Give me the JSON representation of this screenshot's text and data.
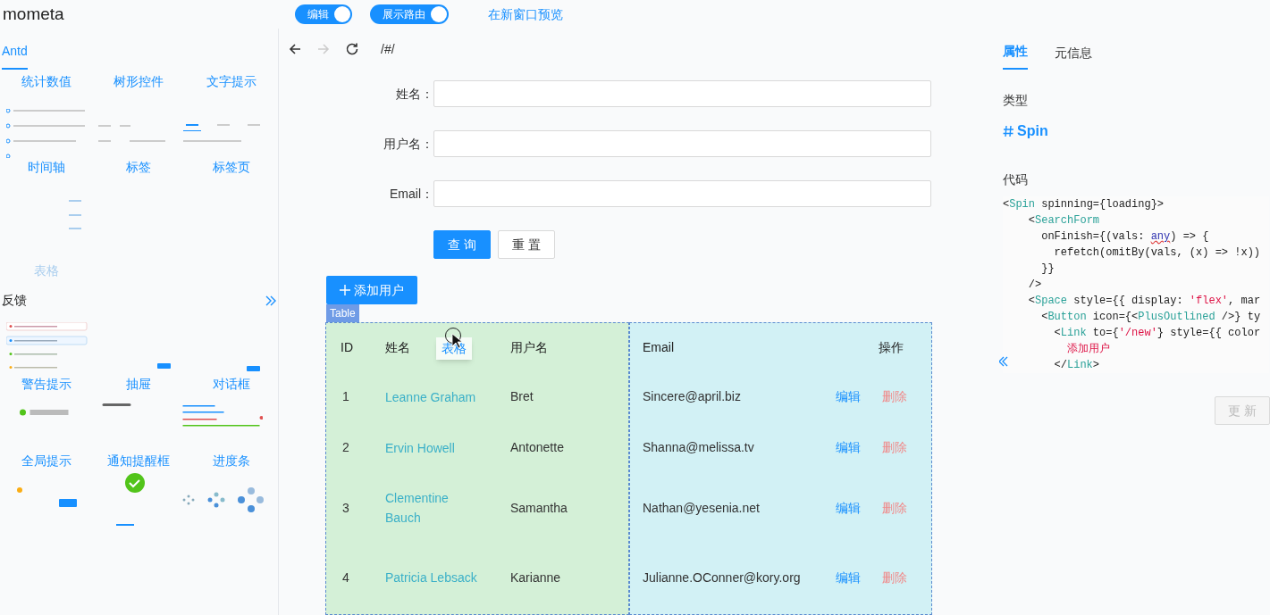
{
  "header": {
    "logo": "mometa",
    "toggles": [
      {
        "label": "编辑",
        "on": true
      },
      {
        "label": "展示路由",
        "on": true
      }
    ],
    "preview_link": "在新窗口预览"
  },
  "left_panel": {
    "tab": {
      "label": "Antd",
      "selected": true
    },
    "sections": [
      {
        "rows": [
          [
            {
              "label": "统计数值",
              "dragging": false
            },
            {
              "label": "树形控件",
              "dragging": false
            },
            {
              "label": "文字提示",
              "dragging": false
            }
          ],
          [
            {
              "label": "时间轴",
              "dragging": false
            },
            {
              "label": "标签",
              "dragging": false
            },
            {
              "label": "标签页",
              "dragging": false
            }
          ],
          [
            {
              "label": "表格",
              "dragging": true
            }
          ]
        ]
      },
      {
        "title": "反馈",
        "rows": [
          [
            {
              "label": "警告提示",
              "dragging": false
            },
            {
              "label": "抽屉",
              "dragging": false
            },
            {
              "label": "对话框",
              "dragging": false
            }
          ],
          [
            {
              "label": "全局提示",
              "dragging": false
            },
            {
              "label": "通知提醒框",
              "dragging": false
            },
            {
              "label": "进度条",
              "dragging": false
            }
          ]
        ]
      }
    ]
  },
  "browser_bar": {
    "back_disabled": false,
    "forward_disabled": true,
    "path": "/#/"
  },
  "form": {
    "fields": [
      {
        "label": "姓名："
      },
      {
        "label": "用户名："
      },
      {
        "label": "Email："
      }
    ],
    "buttons": [
      {
        "label": "查 询",
        "kind": "primary"
      },
      {
        "label": "重 置",
        "kind": "default"
      }
    ]
  },
  "add_button": "添加用户",
  "table": {
    "tag": "Table",
    "drag_ghost": "表格",
    "columns": [
      "ID",
      "姓名",
      "用户名",
      "Email",
      "操作"
    ],
    "rows": [
      {
        "id": "1",
        "name": "Leanne Graham",
        "username": "Bret",
        "email": "Sincere@april.biz",
        "actions": [
          "编辑",
          "删除"
        ]
      },
      {
        "id": "2",
        "name": "Ervin Howell",
        "username": "Antonette",
        "email": "Shanna@melissa.tv",
        "actions": [
          "编辑",
          "删除"
        ]
      },
      {
        "id": "3",
        "name": "Clementine Bauch",
        "username": "Samantha",
        "email": "Nathan@yesenia.net",
        "actions": [
          "编辑",
          "删除"
        ]
      },
      {
        "id": "4",
        "name": "Patricia Lebsack",
        "username": "Karianne",
        "email": "Julianne.OConner@kory.org",
        "actions": [
          "编辑",
          "删除"
        ]
      }
    ]
  },
  "right_panel": {
    "tabs": [
      {
        "label": "属性",
        "selected": true
      },
      {
        "label": "元信息",
        "selected": false
      }
    ],
    "type_label": "类型",
    "type_value": "Spin",
    "code_label": "代码",
    "code": [
      [
        {
          "plain": "<"
        },
        {
          "tag": "Spin"
        },
        {
          "plain": " spinning={loading}>"
        }
      ],
      [
        {
          "plain": "    <"
        },
        {
          "tag": "SearchForm"
        }
      ],
      [
        {
          "plain": "      onFinish={(vals: "
        },
        {
          "type": "any"
        },
        {
          "plain": ") => {"
        }
      ],
      [
        {
          "plain": "        refetch(omitBy(vals, (x) => !x))"
        }
      ],
      [
        {
          "plain": "      }}"
        }
      ],
      [
        {
          "plain": "    />"
        }
      ],
      [
        {
          "plain": "    <"
        },
        {
          "tag": "Space"
        },
        {
          "plain": " style={{ display: "
        },
        {
          "string": "'flex'"
        },
        {
          "plain": ", mar"
        }
      ],
      [
        {
          "plain": "      <"
        },
        {
          "tag": "Button"
        },
        {
          "plain": " icon={<"
        },
        {
          "tag": "PlusOutlined"
        },
        {
          "plain": " />} ty"
        }
      ],
      [
        {
          "plain": "        <"
        },
        {
          "tag": "Link"
        },
        {
          "plain": " to={"
        },
        {
          "string": "'/new'"
        },
        {
          "plain": "} style={{ color"
        }
      ],
      [
        {
          "string": "          添加用户"
        }
      ],
      [
        {
          "plain": "        </"
        },
        {
          "tag": "Link"
        },
        {
          "plain": ">"
        }
      ]
    ],
    "update_button": {
      "label": "更 新",
      "disabled": true
    }
  }
}
